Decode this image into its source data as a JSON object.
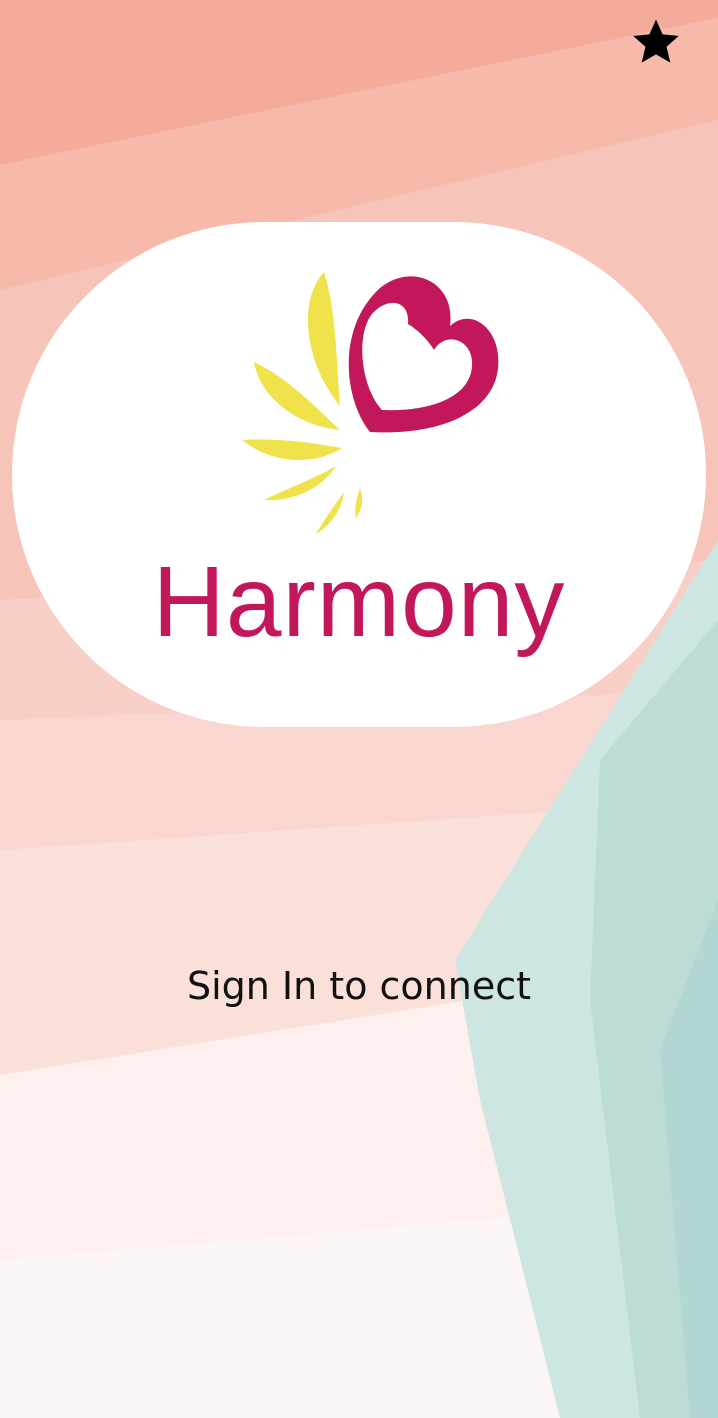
{
  "theme": {
    "brand_color": "#c2185b",
    "petal_color": "#f0e24a",
    "text_color": "#111111"
  },
  "header": {
    "favorite_icon": "star-icon"
  },
  "logo": {
    "brand_name": "Harmony",
    "mark_icon": "heart-butterfly-logo"
  },
  "main": {
    "signin_text": "Sign In to connect"
  }
}
